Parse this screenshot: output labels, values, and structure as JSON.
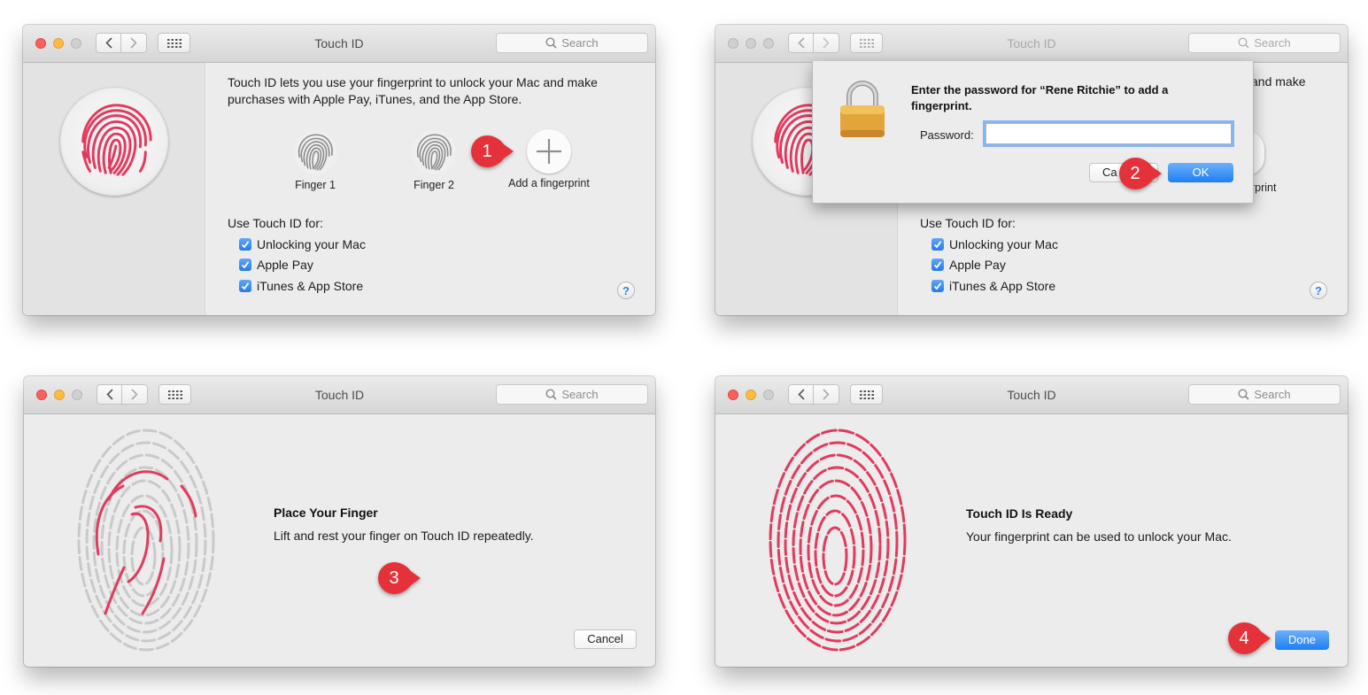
{
  "colors": {
    "accent": "#2779e9",
    "callout": "#e5323a",
    "fingerprint": "#e23a5e",
    "fingerprint_dim": "#c7c7c7"
  },
  "window_title": "Touch ID",
  "search_placeholder": "Search",
  "icons": [
    "back-chevron-icon",
    "forward-chevron-icon",
    "show-all-grid-icon",
    "search-icon",
    "fingerprint-icon",
    "plus-icon",
    "checkmark-icon",
    "lock-icon",
    "help-icon"
  ],
  "panel1": {
    "description": "Touch ID lets you use your fingerprint to unlock your Mac and make purchases with Apple Pay, iTunes, and the App Store.",
    "fingers": [
      "Finger 1",
      "Finger 2"
    ],
    "add_label": "Add a fingerprint",
    "use_for": "Use Touch ID for:",
    "options": [
      "Unlocking your Mac",
      "Apple Pay",
      "iTunes & App Store"
    ],
    "help": "?",
    "step": "1"
  },
  "panel2": {
    "description_visible": "and make",
    "add_label_visible": "erprint",
    "dialog": {
      "message": "Enter the password for “Rene Ritchie” to add a fingerprint.",
      "password_label": "Password:",
      "password_value": "",
      "cancel_visible": "Ca",
      "ok": "OK"
    },
    "use_for": "Use Touch ID for:",
    "options": [
      "Unlocking your Mac",
      "Apple Pay",
      "iTunes & App Store"
    ],
    "help": "?",
    "step": "2"
  },
  "panel3": {
    "title": "Place Your Finger",
    "subtitle": "Lift and rest your finger on Touch ID repeatedly.",
    "cancel": "Cancel",
    "progress": 0.25,
    "step": "3"
  },
  "panel4": {
    "title": "Touch ID Is Ready",
    "subtitle": "Your fingerprint can be used to unlock your Mac.",
    "done": "Done",
    "progress": 1.0,
    "step": "4"
  }
}
